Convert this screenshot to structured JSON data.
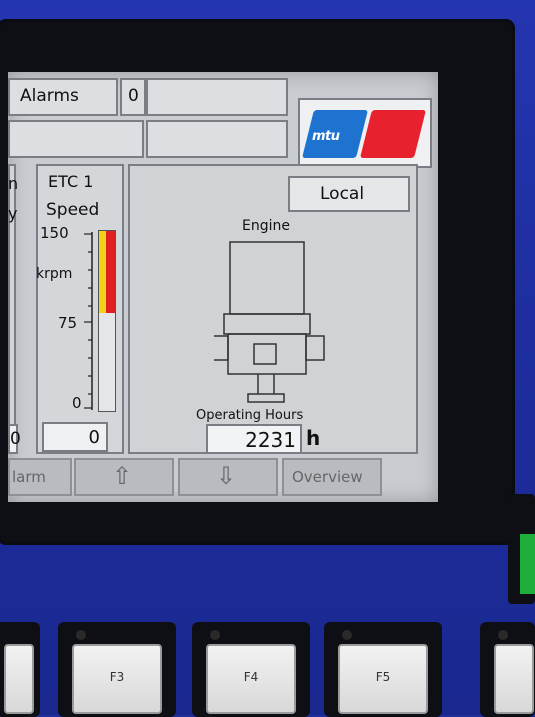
{
  "header": {
    "alarms_label": "Alarms",
    "alarms_count": "0"
  },
  "logo": {
    "text": "mtu"
  },
  "left_column": {
    "partial_top": "n",
    "partial_second": "y",
    "partial_value": "0"
  },
  "gauge": {
    "title": "ETC 1",
    "subtitle": "Speed",
    "tick_150": "150",
    "unit": "krpm",
    "tick_75": "75",
    "tick_0": "0",
    "value": "0",
    "level": 0
  },
  "engine": {
    "mode": "Local",
    "label": "Engine",
    "hours_label": "Operating Hours",
    "hours_value": "2231",
    "hours_unit": "h"
  },
  "softkeys": {
    "alarm": "larm",
    "up": "⇧",
    "down": "⇩",
    "overview": "Overview"
  },
  "fkeys": [
    "F3",
    "F4",
    "F5"
  ],
  "colors": {
    "panel_blue": "#1f2f9a",
    "mtu_blue": "#1e73d0",
    "mtu_red": "#e8212e",
    "gauge_yellow": "#f2d21a",
    "gauge_red": "#e02020"
  }
}
